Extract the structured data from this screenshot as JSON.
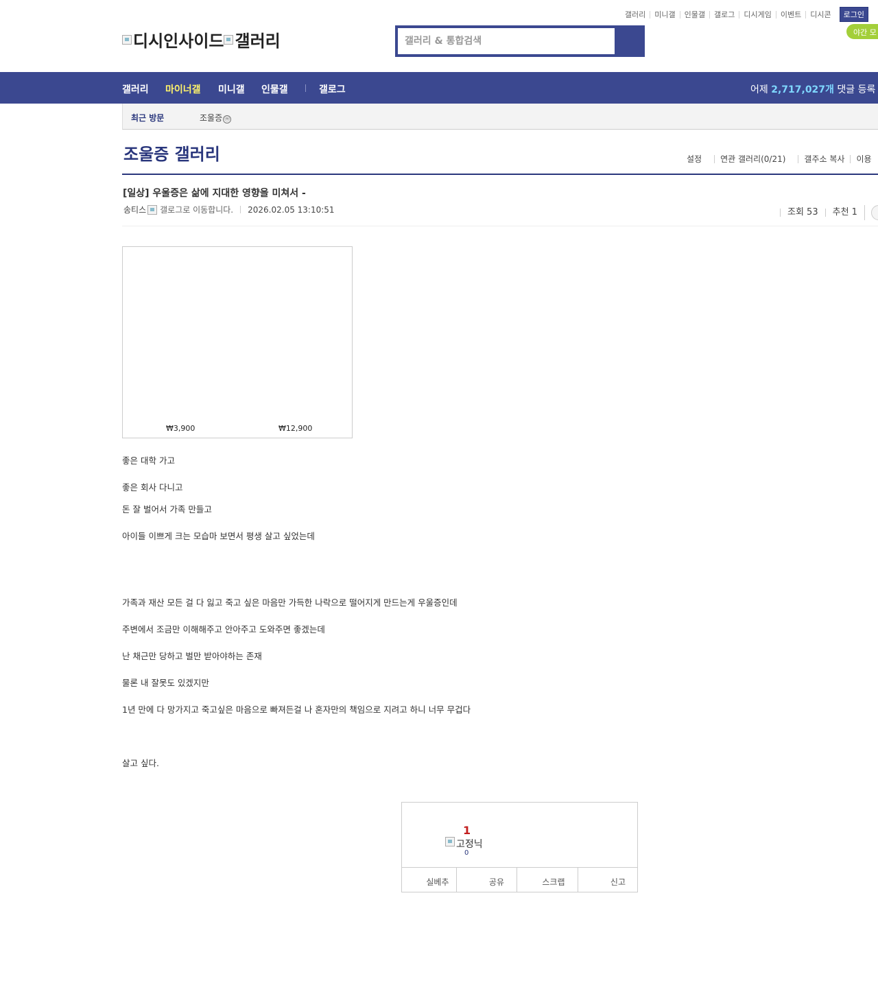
{
  "util_menu": {
    "items": [
      "갤러리",
      "미니갤",
      "인물갤",
      "갤로그",
      "디시게임",
      "이벤트",
      "디시콘"
    ],
    "login": "로그인",
    "night_mode": "야간 모"
  },
  "logo": {
    "site": "디시인사이드",
    "section": "갤러리"
  },
  "search": {
    "placeholder": "갤러리 & 통합검색"
  },
  "nav": {
    "items": [
      "갤러리",
      "마이너갤",
      "미니갤",
      "인물갤",
      "갤로그"
    ],
    "active_index": 1,
    "stat_prefix": "어제 ",
    "stat_value": "2,717,027개",
    "stat_suffix": " 댓글 등록"
  },
  "recent": {
    "label": "최근 방문",
    "gallery": "조울증",
    "minor_badge": "ⓜ"
  },
  "gallery": {
    "title": "조울증 갤러리",
    "tools": [
      "설정",
      "연관 갤러리(0/21)",
      "갤주소 복사",
      "이용"
    ]
  },
  "post": {
    "title": "[일상] 우울증은 삶에 지대한 영향을 미쳐서 -",
    "author": "송티스",
    "gallog_alt": "갤로그로 이동합니다.",
    "date": "2026.02.05 13:10:51",
    "views": "조회 53",
    "recommend": "추천 1",
    "image_prices": [
      "₩3,900",
      "₩12,900"
    ],
    "lines": [
      "좋은 대학 가고",
      "좋은 회사 다니고",
      "돈 잘 벌어서 가족 만들고",
      "아이들 이쁘게 크는 모습마 보면서 평생 살고 싶었는데",
      "가족과 재산 모든 걸 다 잃고 죽고 싶은 마음만 가득한 나락으로 떨어지게 만드는게 우울증인데",
      "주변에서 조금만 이해해주고 안아주고 도와주면 좋겠는데",
      "난 채근만 당하고 벌만 받아야하는 존재",
      "물론 내 잘못도 있겠지만",
      "1년 만에 다 망가지고 죽고싶은 마음으로 빠져든걸 나 혼자만의 책임으로 지려고 하니 너무 무겁다",
      "살고 싶다."
    ]
  },
  "recommend_box": {
    "count": "1",
    "fixed_label": "고정닉",
    "fixed_count": "0",
    "buttons": [
      "실베추",
      "공유",
      "스크랩",
      "신고"
    ]
  },
  "colors": {
    "brand": "#3b4890",
    "brand_dark": "#29367c",
    "highlight": "#fff36a",
    "night": "#a3cf3a"
  }
}
